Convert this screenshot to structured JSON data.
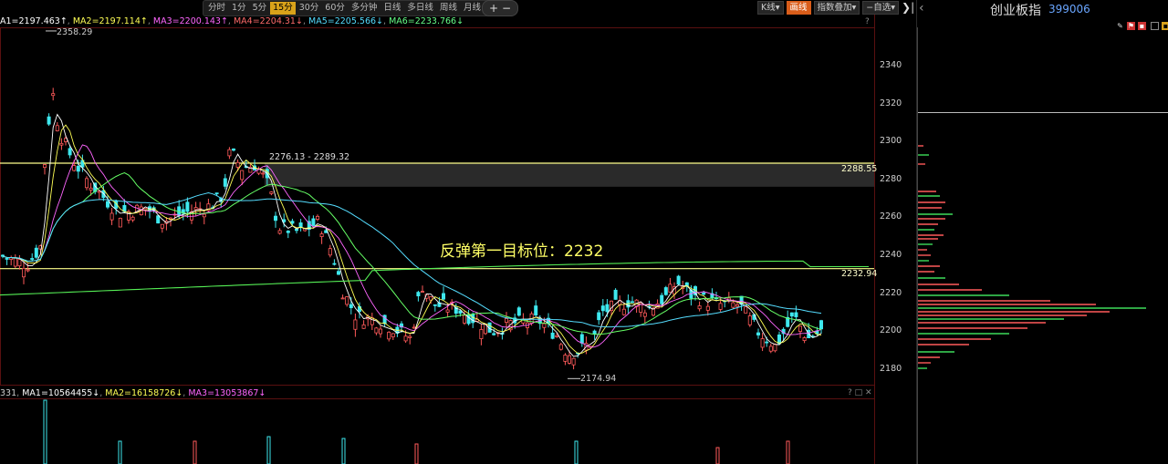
{
  "toolbar": {
    "timeframes": [
      "分时",
      "1分",
      "5分",
      "15分",
      "30分",
      "60分",
      "多分钟",
      "日线",
      "多日线",
      "周线",
      "月线 ▾"
    ],
    "active_timeframe": "15分",
    "zoom_in": "+",
    "zoom_out": "−",
    "kline_label": "K线▾",
    "draw_label": "画线",
    "overlay_label": "指数叠加▾",
    "watchlist_label": "−自选▾",
    "close_icon": "❯|"
  },
  "ma_legend": {
    "ma0": "A1=2197.463↑",
    "ma2": "MA2=2197.114↑",
    "ma3": "MA3=2200.143↑",
    "ma4": "MA4=2204.31↓",
    "ma5": "MA5=2205.566↓",
    "ma6": "MA6=2233.766↓",
    "help": "?"
  },
  "vol_legend": {
    "vol": "331",
    "ma1": "MA1=10564455↓",
    "ma2": "MA2=16158726↓",
    "ma3": "MA3=13053867↓",
    "icons": "? □ ✕"
  },
  "annotations": {
    "high_label": "2358.29",
    "low_label": "2174.94",
    "range_label": "2276.13 - 2289.32",
    "upper_line_label": "2288.55",
    "lower_line_label": "2232.94",
    "target_text": "反弹第一目标位：2232"
  },
  "price_axis": [
    "2340",
    "2320",
    "2300",
    "2280",
    "2260",
    "2240",
    "2220",
    "2200",
    "2180"
  ],
  "right_panel": {
    "back_icon": "‹",
    "title": "创业板指",
    "code": "399006"
  },
  "colors": {
    "up": "#ff5a5a",
    "down": "#3ee8ee",
    "hline": "#ffff8c",
    "ma1": "#ffffff",
    "ma2": "#ffff55",
    "ma3": "#ff66ff",
    "ma4": "#66ff66",
    "target_text": "#ffff66"
  }
}
